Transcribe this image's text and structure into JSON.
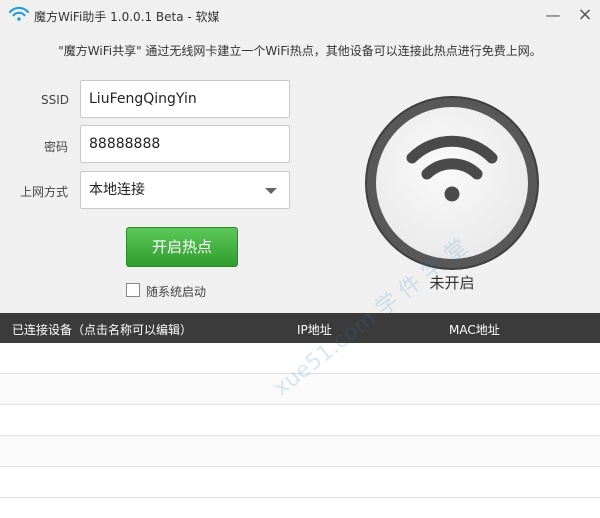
{
  "window": {
    "title": "魔方WiFi助手 1.0.0.1 Beta - 软媒",
    "minimize_glyph": "—",
    "close_glyph": "×",
    "title_icon": "wifi-icon"
  },
  "description": "\"魔方WiFi共享\" 通过无线网卡建立一个WiFi热点，其他设备可以连接此热点进行免费上网。",
  "form": {
    "ssid_label": "SSID",
    "ssid_value": "LiuFengQingYin",
    "password_label": "密码",
    "password_value": "88888888",
    "mode_label": "上网方式",
    "mode_value": "本地连接"
  },
  "start_button_label": "开启热点",
  "autostart": {
    "label": "随系统启动",
    "checked": false
  },
  "hotspot": {
    "status": "未开启",
    "icon": "wifi-icon"
  },
  "table": {
    "columns": [
      "已连接设备（点击名称可以编辑）",
      "IP地址",
      "MAC地址"
    ],
    "rows": []
  },
  "watermark": "xue51.com 学 件 学 堂",
  "colors": {
    "accent_green": "#3cae3a",
    "header_dark": "#3b3b3b",
    "title_icon": "#2a9bd8"
  }
}
